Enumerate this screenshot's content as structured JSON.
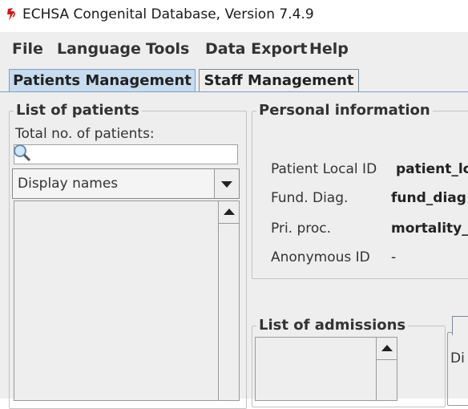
{
  "window": {
    "title": "ECHSA Congenital Database, Version 7.4.9"
  },
  "menu": {
    "items": [
      {
        "label": "File"
      },
      {
        "label": "Language"
      },
      {
        "label": "Tools"
      },
      {
        "label": "Data Export"
      },
      {
        "label": "Help"
      }
    ]
  },
  "tabs": [
    {
      "label": "Patients Management",
      "active": true
    },
    {
      "label": "Staff Management",
      "active": false
    }
  ],
  "patients_panel": {
    "title": "List of patients",
    "total_label": "Total no. of patients:",
    "search_value": "",
    "display_select": "Display names"
  },
  "personal_info": {
    "title": "Personal information",
    "fields": [
      {
        "label": "Patient Local ID",
        "value": "patient_lc"
      },
      {
        "label": "Fund. Diag.",
        "value": "fund_diag"
      },
      {
        "label": "Pri. proc.",
        "value": "mortality_"
      },
      {
        "label": "Anonymous ID",
        "value": "-"
      }
    ]
  },
  "admissions": {
    "title": "List of admissions"
  },
  "right_tab_fragment": {
    "text": "Di"
  },
  "colors": {
    "active_tab": "#c8dcef",
    "panel_bg": "#eeeeee",
    "accent_border": "#7a9fc3"
  }
}
